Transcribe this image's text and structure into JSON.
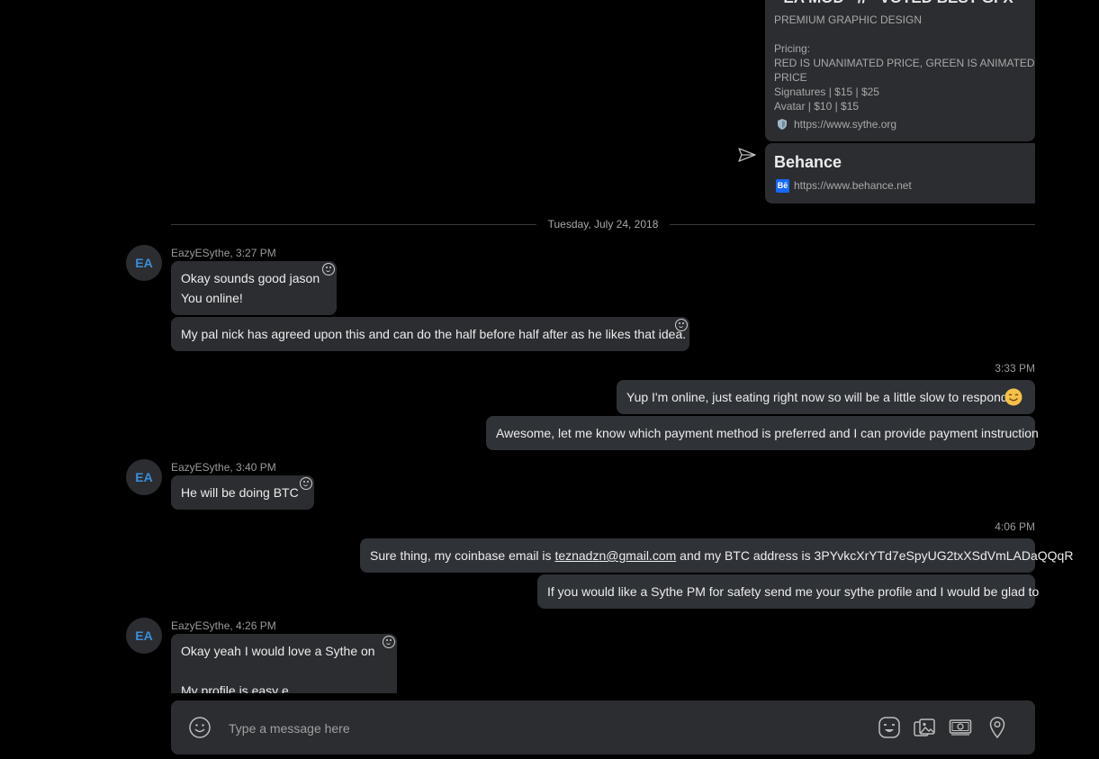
{
  "cards": {
    "sythe": {
      "title": "- EA MOD - // - VOTED BEST GFX",
      "subtitle": "PREMIUM GRAPHIC DESIGN",
      "lines": [
        "Pricing:",
        "RED IS UNANIMATED PRICE, GREEN IS ANIMATED",
        "PRICE",
        "Signatures | $15  | $25",
        "Avatar | $10 | $15"
      ],
      "url": "https://www.sythe.org"
    },
    "behance": {
      "title": "Behance",
      "icon_text": "Bē",
      "url": "https://www.behance.net"
    }
  },
  "date_divider": "Tuesday, July 24, 2018",
  "groups": {
    "g1": {
      "avatar": "EA",
      "meta": "EazyESythe, 3:27 PM",
      "msg1_line1": "Okay sounds good jason",
      "msg1_line2": "You online!",
      "msg2": "My pal nick has agreed upon this and can do the half before half after as he likes that idea."
    },
    "g2": {
      "time": "3:33 PM",
      "msg1": "Yup I'm online, just eating right now so will be a little slow to respond",
      "msg2": "Awesome, let me know which payment method is preferred and I can provide payment instruction"
    },
    "g3": {
      "avatar": "EA",
      "meta": "EazyESythe, 3:40 PM",
      "msg1": "He will be doing BTC"
    },
    "g4": {
      "time": "4:06 PM",
      "msg1_pre": "Sure thing, my coinbase email is ",
      "msg1_link": "teznadzn@gmail.com",
      "msg1_post": " and my BTC address is 3PYvkcXrYTd7eSpyUG2txXSdVmLADaQQqR",
      "msg2": "If you would like a Sythe PM for safety send me your sythe profile and I would be glad to"
    },
    "g5": {
      "avatar": "EA",
      "meta": "EazyESythe, 4:26 PM",
      "msg1_line1": "Okay yeah I would love a Sythe on",
      "msg1_line3": "My profile is easy e"
    }
  },
  "composer": {
    "placeholder": "Type a message here"
  },
  "colors": {
    "background": "#000000",
    "bubble": "#2b2d31",
    "avatar_text": "#3b8ed8",
    "behance_blue": "#1769ff"
  }
}
